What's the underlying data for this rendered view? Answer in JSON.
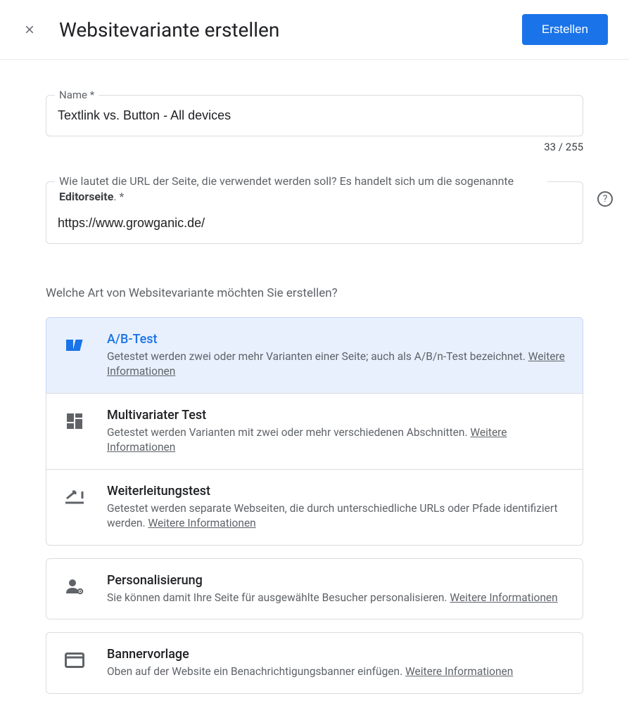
{
  "header": {
    "title": "Websitevariante erstellen",
    "create_button": "Erstellen"
  },
  "name_field": {
    "label": "Name *",
    "value": "Textlink vs. Button - All devices",
    "counter": "33 / 255"
  },
  "url_field": {
    "label_pre": "Wie lautet die URL der Seite, die verwendet werden soll? Es handelt sich um die sogenannte ",
    "label_bold": "Editorseite",
    "label_post": ". *",
    "value": "https://www.growganic.de/"
  },
  "section_question": "Welche Art von Websitevariante möchten Sie erstellen?",
  "more_info": "Weitere Informationen",
  "options": {
    "ab": {
      "title": "A/B-Test",
      "desc": "Getestet werden zwei oder mehr Varianten einer Seite; auch als A/B/n-Test bezeichnet."
    },
    "multi": {
      "title": "Multivariater Test",
      "desc": "Getestet werden Varianten mit zwei oder mehr verschiedenen Abschnitten."
    },
    "redirect": {
      "title": "Weiterleitungstest",
      "desc": "Getestet werden separate Webseiten, die durch unterschiedliche URLs oder Pfade identifiziert werden."
    },
    "personal": {
      "title": "Personalisierung",
      "desc": "Sie können damit Ihre Seite für ausgewählte Besucher personalisieren."
    },
    "banner": {
      "title": "Bannervorlage",
      "desc": "Oben auf der Website ein Benachrichtigungsbanner einfügen."
    }
  }
}
